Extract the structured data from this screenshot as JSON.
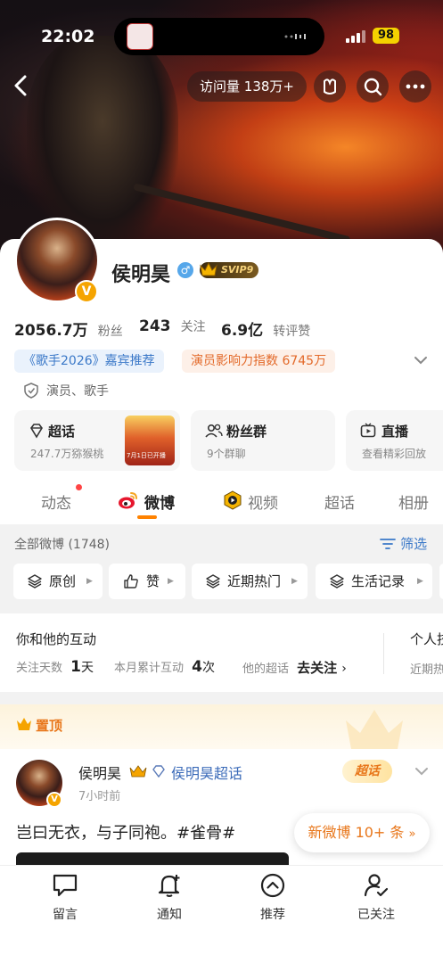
{
  "status_bar": {
    "time": "22:02",
    "battery": "98"
  },
  "header": {
    "visits_label": "访问量 138万+"
  },
  "profile": {
    "name": "侯明昊",
    "vip_level": "SVIP9",
    "verified_badge": "V",
    "stats": [
      {
        "value": "2056.7万",
        "label": "粉丝"
      },
      {
        "value": "243",
        "label": "关注"
      },
      {
        "value": "6.9亿",
        "label": "转评赞"
      }
    ],
    "tags": {
      "guest": "《歌手2026》嘉宾推荐",
      "influence": "演员影响力指数 6745万"
    },
    "roles": "演员、歌手"
  },
  "features": [
    {
      "title": "超话",
      "subtitle": "247.7万猕猴桃",
      "thumb_caption": "7月1日已开播"
    },
    {
      "title": "粉丝群",
      "subtitle": "9个群聊"
    },
    {
      "title": "直播",
      "subtitle": "查看精彩回放"
    }
  ],
  "tabs": [
    {
      "label": "动态"
    },
    {
      "label": "微博"
    },
    {
      "label": "视频"
    },
    {
      "label": "超话"
    },
    {
      "label": "相册"
    }
  ],
  "weibo_section": {
    "all_count_label": "全部微博 (1748)",
    "filter_label": "筛选",
    "chips": [
      "原创",
      "赞",
      "近期热门",
      "生活记录"
    ]
  },
  "interaction": {
    "title": "你和他的互动",
    "side_title": "个人技",
    "side_sub": "近期热",
    "follow_days_label": "关注天数",
    "follow_days_value": "1",
    "follow_days_unit": "天",
    "month_label": "本月累计互动",
    "month_value": "4",
    "month_unit": "次",
    "topic_label": "他的超话",
    "topic_action": "去关注"
  },
  "pinned": {
    "label": "置顶"
  },
  "post": {
    "author": "侯明昊",
    "topic_link": "侯明昊超话",
    "time": "7小时前",
    "badge": "超话",
    "text": "岂曰无衣，与子同袍。#雀骨#"
  },
  "new_posts_label": "新微博 10+ 条",
  "bottom_bar": [
    {
      "label": "留言",
      "icon": "chat-icon"
    },
    {
      "label": "通知",
      "icon": "bell-plus-icon"
    },
    {
      "label": "推荐",
      "icon": "chevron-up-circle-icon"
    },
    {
      "label": "已关注",
      "icon": "user-check-icon"
    }
  ]
}
